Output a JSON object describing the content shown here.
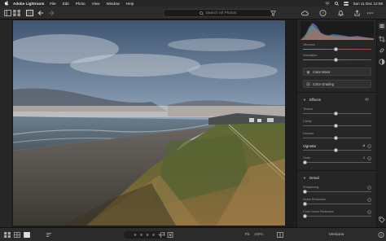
{
  "menubar": {
    "app_name": "Adobe Lightroom",
    "items": [
      "File",
      "Edit",
      "Photo",
      "View",
      "Window",
      "Help"
    ],
    "clock": "Sun 11 Dec  12:06"
  },
  "toolbar": {
    "search_placeholder": "Search All Photos"
  },
  "panel": {
    "sliders_top": [
      {
        "label": "Vibrance",
        "value": "",
        "position": 0.48
      },
      {
        "label": "Saturation",
        "value": "",
        "position": 0.48
      }
    ],
    "color_mixer_label": "Color Mixer",
    "color_grading_label": "Color Grading",
    "effects": {
      "title": "Effects",
      "sliders": [
        {
          "label": "Texture",
          "value": "",
          "position": 0.48
        },
        {
          "label": "Clarity",
          "value": "",
          "position": 0.48
        },
        {
          "label": "Dehaze",
          "value": "",
          "position": 0.48
        }
      ],
      "vignette": {
        "label": "Vignette",
        "value": "-8",
        "position": 0.48
      },
      "grain": {
        "label": "Grain",
        "value": "0",
        "position": 0.0
      }
    },
    "detail": {
      "title": "Detail",
      "sliders": [
        {
          "label": "Sharpening",
          "value": "",
          "position": 0.0
        },
        {
          "label": "Noise Reduction",
          "value": "",
          "position": 0.0
        },
        {
          "label": "Color Noise Reduction",
          "value": "",
          "position": 0.0
        }
      ]
    }
  },
  "bottombar": {
    "fit_label": "Fit",
    "zoom_label": "100%",
    "versions_label": "Versions"
  },
  "colors": {
    "panel_bg": "#262626",
    "accent": "#2d8ceb"
  }
}
